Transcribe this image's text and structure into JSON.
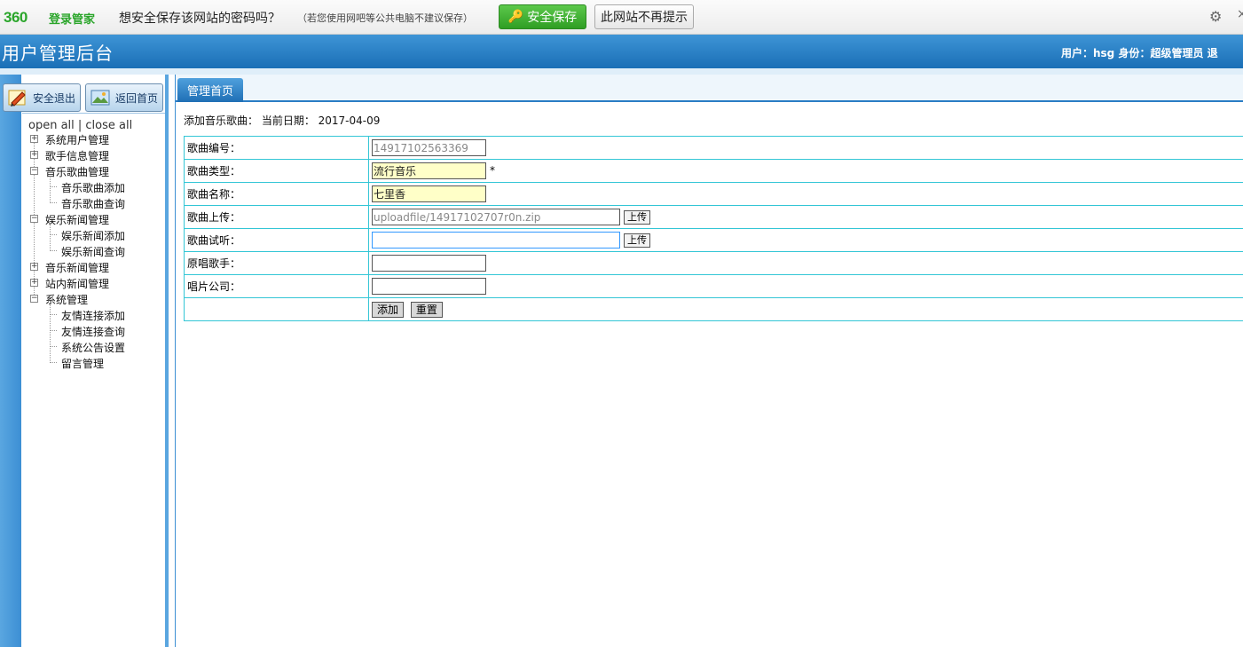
{
  "pwbar": {
    "logo": "360",
    "logo_sub": "登录管家",
    "question": "想安全保存该网站的密码吗？",
    "hint": "（若您使用网吧等公共电脑不建议保存）",
    "save_label": "安全保存",
    "never_label": "此网站不再提示"
  },
  "header": {
    "title": "用户管理后台",
    "userinfo": "用户：hsg  身份：超级管理员   退"
  },
  "sidebar": {
    "logout_label": "安全退出",
    "home_label": "返回首页",
    "openclose": "open all | close all",
    "tree": [
      "系统用户管理",
      "歌手信息管理",
      "音乐歌曲管理",
      "音乐歌曲添加",
      "音乐歌曲查询",
      "娱乐新闻管理",
      "娱乐新闻添加",
      "娱乐新闻查询",
      "音乐新闻管理",
      "站内新闻管理",
      "系统管理",
      "友情连接添加",
      "友情连接查询",
      "系统公告设置",
      "留言管理"
    ]
  },
  "main": {
    "tab_label": "管理首页",
    "crumb": "添加音乐歌曲：  当前日期： 2017-04-09",
    "form": {
      "song_id_label": "歌曲编号：",
      "song_id_value": "14917102563369",
      "song_type_label": "歌曲类型：",
      "song_type_value": "流行音乐",
      "required_mark": "*",
      "song_name_label": "歌曲名称：",
      "song_name_value": "七里香",
      "song_upload_label": "歌曲上传：",
      "song_upload_value": "uploadfile/14917102707r0n.zip",
      "song_listen_label": "歌曲试听：",
      "song_listen_value": "",
      "upload_label": "上传",
      "singer_label": "原唱歌手：",
      "singer_value": "",
      "company_label": "唱片公司：",
      "company_value": "",
      "add_label": "添加",
      "reset_label": "重置"
    }
  }
}
